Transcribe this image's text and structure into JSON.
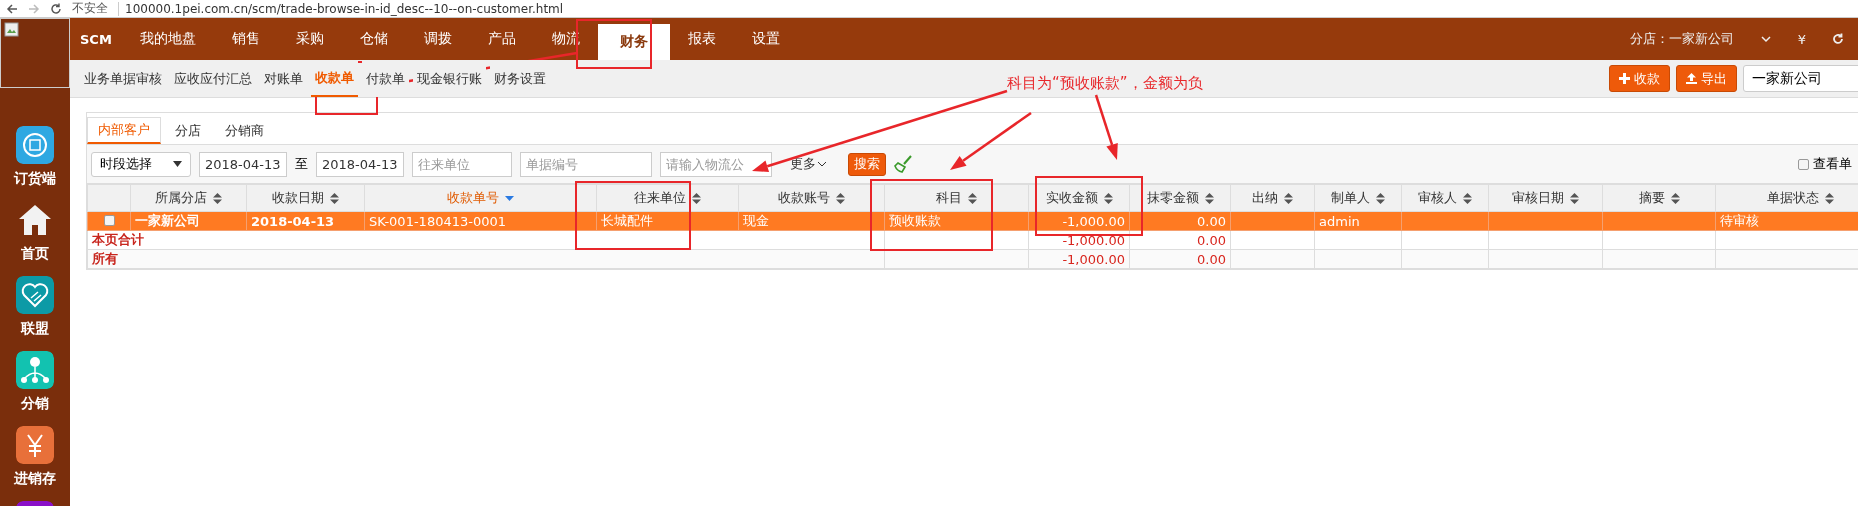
{
  "address_bar": {
    "security": "不安全",
    "url": "100000.1pei.com.cn/scm/trade-browse-in-id_desc--10--on-customer.html"
  },
  "top_nav": {
    "brand": "SCM",
    "items": [
      {
        "label": "我的地盘",
        "selected": false
      },
      {
        "label": "销售",
        "selected": false
      },
      {
        "label": "采购",
        "selected": false
      },
      {
        "label": "仓储",
        "selected": false
      },
      {
        "label": "调拨",
        "selected": false
      },
      {
        "label": "产品",
        "selected": false
      },
      {
        "label": "物流",
        "selected": false
      },
      {
        "label": "财务",
        "selected": true
      },
      {
        "label": "报表",
        "selected": false
      },
      {
        "label": "设置",
        "selected": false
      }
    ],
    "store": "分店：一家新公司",
    "currency": "¥"
  },
  "sidebar": {
    "items": [
      {
        "label": "订货端",
        "kind": "order",
        "color": "#2ea8e2"
      },
      {
        "label": "首页",
        "kind": "home"
      },
      {
        "label": "联盟",
        "kind": "heart",
        "color": "#0c9aa6"
      },
      {
        "label": "分销",
        "kind": "tree",
        "color": "#12c2b0"
      },
      {
        "label": "进销存",
        "kind": "yen",
        "color": "#e8703a"
      },
      {
        "kind": "app",
        "color": "#8a10c8"
      }
    ]
  },
  "sub_nav": {
    "items": [
      {
        "label": "业务单据审核",
        "selected": false
      },
      {
        "label": "应收应付汇总",
        "selected": false
      },
      {
        "label": "对账单",
        "selected": false
      },
      {
        "label": "收款单",
        "selected": true
      },
      {
        "label": "付款单",
        "selected": false
      },
      {
        "label": "现金银行账",
        "selected": false
      },
      {
        "label": "财务设置",
        "selected": false
      }
    ],
    "buttons": [
      {
        "label": "收款",
        "kind": "add"
      },
      {
        "label": "导出",
        "kind": "export"
      }
    ],
    "store_select": "一家新公司"
  },
  "tabs": [
    {
      "label": "内部客户",
      "selected": true
    },
    {
      "label": "分店",
      "selected": false
    },
    {
      "label": "分销商",
      "selected": false
    }
  ],
  "filters": {
    "period": "时段选择",
    "date_from": "2018-04-13",
    "separator": "至",
    "date_to": "2018-04-13",
    "fields": [
      {
        "placeholder": "往来单位"
      },
      {
        "placeholder": "单据编号"
      },
      {
        "placeholder": "请输入物流公"
      }
    ],
    "more": "更多",
    "search": "搜索",
    "view_checkbox": {
      "label": "查看单",
      "checked": false
    }
  },
  "table": {
    "columns": [
      {
        "label": "所属分店",
        "sorted": false
      },
      {
        "label": "收款日期",
        "sorted": false
      },
      {
        "label": "收款单号",
        "sorted": true
      },
      {
        "label": "往来单位",
        "sorted": false
      },
      {
        "label": "收款账号",
        "sorted": false
      },
      {
        "label": "科目",
        "sorted": false
      },
      {
        "label": "实收金额",
        "sorted": false
      },
      {
        "label": "抹零金额",
        "sorted": false
      },
      {
        "label": "出纳",
        "sorted": false
      },
      {
        "label": "制单人",
        "sorted": false
      },
      {
        "label": "审核人",
        "sorted": false
      },
      {
        "label": "审核日期",
        "sorted": false
      },
      {
        "label": "摘要",
        "sorted": false
      },
      {
        "label": "单据状态",
        "sorted": false
      }
    ],
    "rows": [
      {
        "selected": true,
        "checked": false,
        "cells": [
          "一家新公司",
          "2018-04-13",
          "SK-001-180413-0001",
          "长城配件",
          "现金",
          "预收账款",
          "-1,000.00",
          "0.00",
          null,
          "admin",
          null,
          null,
          null,
          "待审核"
        ]
      }
    ],
    "totals": [
      {
        "label": "本页合计",
        "amount": "-1,000.00",
        "discount": "0.00"
      },
      {
        "label": "所有",
        "amount": "-1,000.00",
        "discount": "0.00"
      }
    ]
  },
  "annotation": {
    "note": "科目为“预收账款”，金额为负"
  }
}
